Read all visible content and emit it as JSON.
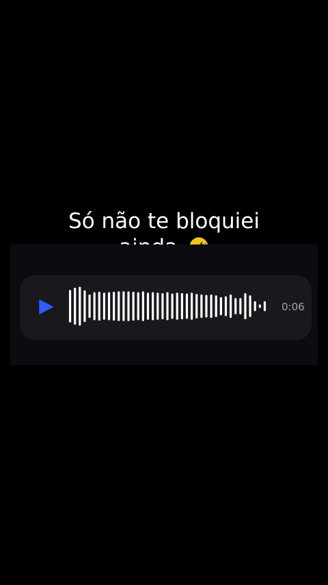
{
  "caption": {
    "line1": "Só não te bloquiei",
    "line2": "ainda.",
    "emoji": "rolling-on-floor-laughing"
  },
  "voice_message": {
    "play_icon": "play-icon",
    "duration": "0:06",
    "play_color": "#2f5bff",
    "waveform_color": "#ffffff",
    "waveform_levels": [
      0.72,
      0.82,
      0.86,
      0.7,
      0.52,
      0.62,
      0.64,
      0.6,
      0.62,
      0.64,
      0.66,
      0.66,
      0.66,
      0.64,
      0.62,
      0.66,
      0.6,
      0.62,
      0.6,
      0.58,
      0.62,
      0.56,
      0.6,
      0.58,
      0.56,
      0.6,
      0.54,
      0.52,
      0.5,
      0.52,
      0.48,
      0.4,
      0.44,
      0.52,
      0.36,
      0.36,
      0.58,
      0.48,
      0.22,
      0.08,
      0.22
    ]
  }
}
